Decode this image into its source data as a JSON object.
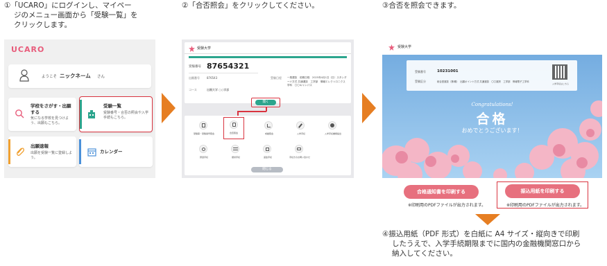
{
  "steps": {
    "s1": [
      "①「UCARO」にログインし、マイペー",
      "ジのメニュー画面から「受験一覧」を",
      "クリックします。"
    ],
    "s2": "②「合否照会」をクリックしてください。",
    "s3": "③合否を照会できます。",
    "s4": [
      "④振込用紙（PDF 形式）を白紙に A4 サイズ・縦向きで印刷",
      "したうえで、入学手続期限までに国内の金融機関窓口から",
      "納入してください。"
    ]
  },
  "panel1": {
    "logo": "UCARO",
    "greeting": "ようこそ",
    "username": "ニックネーム",
    "honorific": "さん",
    "tiles": [
      {
        "title": "学校をさがす・出願する",
        "desc": "気になる学校を見つけよう、出願もこちら。"
      },
      {
        "title": "受験一覧",
        "desc": "受験番号・合否の照会や入学手続もこちら。"
      },
      {
        "title": "出願速報",
        "desc": "出願を受験一覧に登録しよう。"
      },
      {
        "title": "カレンダー",
        "desc": ""
      }
    ]
  },
  "panel2": {
    "school": "受験大学",
    "exam_label": "受験番号",
    "exam_number": "87654321",
    "applicant_label": "出願番号",
    "applicant_number": "876543",
    "course_label": "コース",
    "course_value": "出願大学 ○○学部",
    "exam_info_label": "受験日程",
    "exam_info": "一般選抜　前期日程　2025年4月1日（日）スタンダード方式 共通選抜　工学部　情報エレクトロニクス学科　〇〇キャンパス",
    "pill": "開く",
    "menu": [
      {
        "label": "受験票・受験番号照会"
      },
      {
        "label": "合否照会"
      },
      {
        "label": "成績照会"
      },
      {
        "label": "入学手続"
      },
      {
        "label": "入学手続書類提出"
      },
      {
        "label": "辞退手続"
      },
      {
        "label": "振替手続"
      },
      {
        "label": "返金手続"
      },
      {
        "label": "手続きのお問い合わせ"
      }
    ],
    "close_btn": "閉じる"
  },
  "panel3": {
    "school": "受験大学",
    "exam_label": "受験番号",
    "exam_number": "10231001",
    "info_label": "受験区分",
    "info": "総合型選抜（第Ⅰ期）　出願ポイント方式 共通選抜　〇〇選択　工学部　情報電子工学科",
    "qr_caption": "入学手続はこちら",
    "congrats": "Congratulations!",
    "result": "合格",
    "message": "おめでとうございます！",
    "btn1": "合格通知書を印刷する",
    "btn2": "振込用紙を印刷する",
    "note1": "※印刷用のPDFファイルが出力されます。",
    "note2": "※印刷用のPDFファイルが出力されます。"
  },
  "colors": {
    "accent": "#e67e22",
    "highlight": "#d9333f",
    "brand": "#e85c7b",
    "teal": "#2ca58d",
    "sky": "#4a90d9"
  }
}
